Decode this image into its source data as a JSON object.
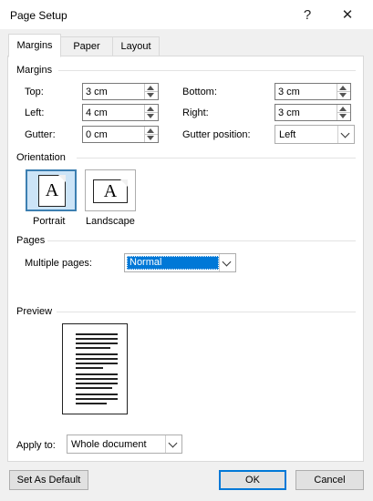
{
  "window": {
    "title": "Page Setup",
    "help": "?",
    "close": "✕"
  },
  "tabs": [
    {
      "label": "Margins",
      "active": true
    },
    {
      "label": "Paper",
      "active": false
    },
    {
      "label": "Layout",
      "active": false
    }
  ],
  "margins": {
    "section_title": "Margins",
    "top": {
      "label": "Top:",
      "value": "3 cm"
    },
    "bottom": {
      "label": "Bottom:",
      "value": "3 cm"
    },
    "left": {
      "label": "Left:",
      "value": "4 cm"
    },
    "right": {
      "label": "Right:",
      "value": "3 cm"
    },
    "gutter": {
      "label": "Gutter:",
      "value": "0 cm"
    },
    "gutter_position": {
      "label": "Gutter position:",
      "value": "Left"
    }
  },
  "orientation": {
    "section_title": "Orientation",
    "portrait": {
      "label": "Portrait",
      "glyph": "A",
      "selected": true
    },
    "landscape": {
      "label": "Landscape",
      "glyph": "A",
      "selected": false
    }
  },
  "pages": {
    "section_title": "Pages",
    "multiple_pages": {
      "label": "Multiple pages:",
      "value": "Normal"
    }
  },
  "preview": {
    "section_title": "Preview"
  },
  "apply_to": {
    "label": "Apply to:",
    "value": "Whole document"
  },
  "buttons": {
    "set_default": "Set As Default",
    "ok": "OK",
    "cancel": "Cancel"
  },
  "colors": {
    "accent": "#0078d7",
    "selected_bg": "#cce4f7",
    "dialog_bg": "#f0f0f0"
  }
}
